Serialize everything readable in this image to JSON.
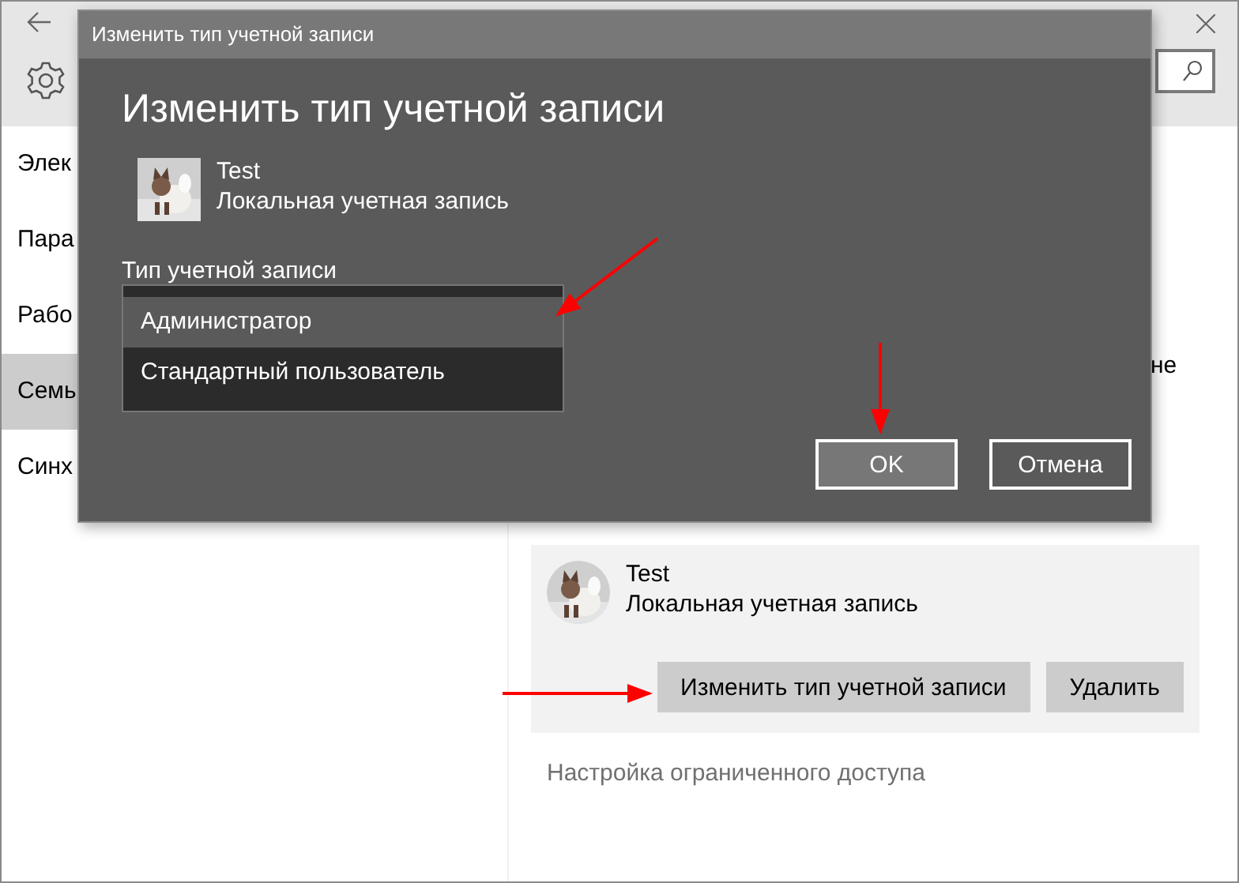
{
  "sidebar": {
    "items": [
      {
        "label": "Элек",
        "selected": false
      },
      {
        "label": "Пара",
        "selected": false
      },
      {
        "label": "Рабо",
        "selected": false
      },
      {
        "label": "Семь",
        "selected": true
      },
      {
        "label": "Синх",
        "selected": false
      }
    ]
  },
  "content": {
    "fragment": "не",
    "account": {
      "name": "Test",
      "type": "Локальная учетная запись",
      "buttons": [
        "Изменить тип учетной записи",
        "Удалить"
      ]
    },
    "link": "Настройка ограниченного доступа"
  },
  "dialog": {
    "title": "Изменить тип учетной записи",
    "heading": "Изменить тип учетной записи",
    "user": {
      "name": "Test",
      "type": "Локальная учетная запись"
    },
    "field_label": "Тип учетной записи",
    "options": [
      {
        "label": "Администратор",
        "selected": true
      },
      {
        "label": "Стандартный пользователь",
        "selected": false
      }
    ],
    "buttons": [
      {
        "label": "OK",
        "highlighted": true
      },
      {
        "label": "Отмена",
        "highlighted": false
      }
    ]
  }
}
